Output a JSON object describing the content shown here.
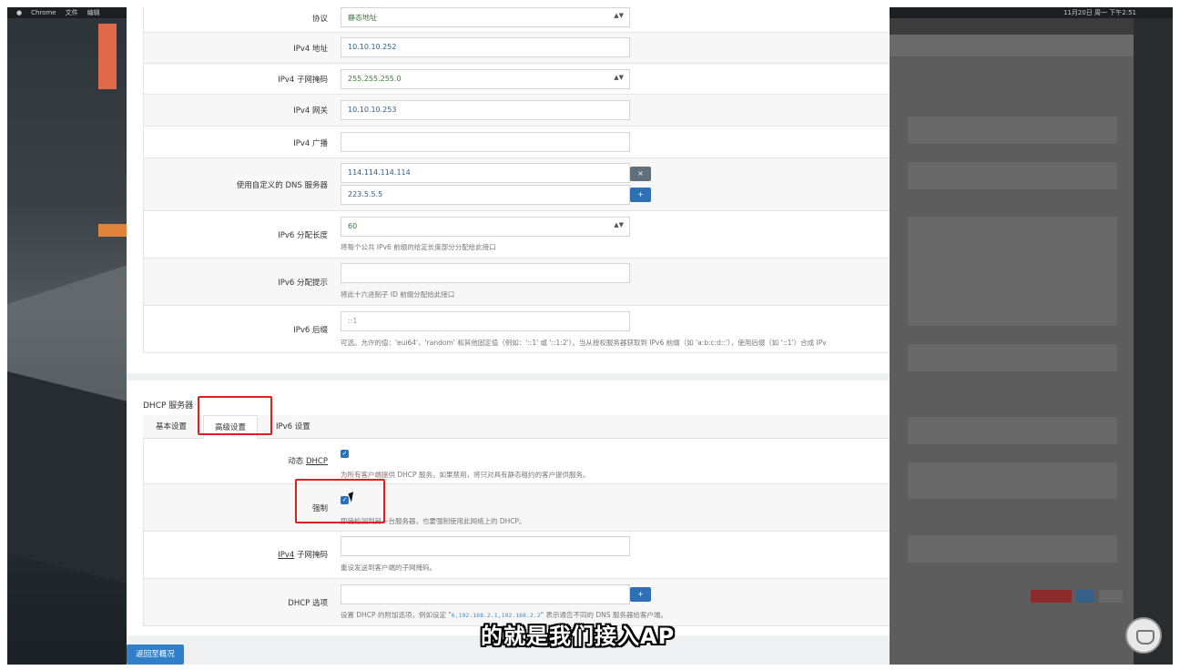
{
  "menubar": {
    "app": "Chrome",
    "items": [
      "文件",
      "编辑"
    ],
    "clock": "11月20日 周一 下午2:51"
  },
  "network": {
    "protocol": {
      "label": "协议",
      "value": "静态地址"
    },
    "ipv4_address": {
      "label": "IPv4 地址",
      "value": "10.10.10.252"
    },
    "ipv4_netmask": {
      "label": "IPv4 子网掩码",
      "value": "255.255.255.0"
    },
    "ipv4_gateway": {
      "label": "IPv4 网关",
      "value": "10.10.10.253"
    },
    "ipv4_broadcast": {
      "label": "IPv4 广播",
      "value": ""
    },
    "dns": {
      "label": "使用自定义的 DNS 服务器",
      "values": [
        "114.114.114.114",
        "223.5.5.5"
      ],
      "remove_btn": "×",
      "add_btn": "+"
    },
    "ipv6_assign_len": {
      "label": "IPv6 分配长度",
      "value": "60",
      "hint": "将每个公共 IPv6 前缀的给定长度部分分配给此接口"
    },
    "ipv6_assign_hint": {
      "label": "IPv6 分配提示",
      "value": "",
      "hint": "将此十六进制子 ID 前缀分配给此接口"
    },
    "ipv6_suffix": {
      "label": "IPv6 后缀",
      "value": "::1",
      "hint": "可选。允许的值：'eui64'、'random' 和其他固定值（例如：'::1' 或 '::1:2'）。当从授权服务器获取到 IPv6 前缀（如 'a:b:c:d::'），使用后缀（如 '::1'）合成 IPv"
    }
  },
  "dhcp": {
    "title": "DHCP 服务器",
    "tabs": [
      "基本设置",
      "高级设置",
      "IPv6 设置"
    ],
    "dynamic": {
      "label_prefix": "动态 ",
      "label_link": "DHCP",
      "checked": true,
      "hint": "为所有客户端提供 DHCP 服务。如果禁用，将只对具有静态租约的客户提供服务。"
    },
    "force": {
      "label": "强制",
      "checked": true,
      "hint": "即使检测到另一台服务器，也要强制使用此网络上的 DHCP。"
    },
    "netmask": {
      "label_link": "IPv4",
      "label_suffix": " 子网掩码",
      "value": "",
      "hint": "重设发送到客户端的子网掩码。"
    },
    "options": {
      "label": "DHCP 选项",
      "value": "",
      "add_btn": "+",
      "hint_prefix": "设置 DHCP 的附加选项，例如设定 \"",
      "hint_code": "6,192.168.2.1,192.168.2.2",
      "hint_suffix": "\" 表示通告不同的 DNS 服务器给客户端。"
    }
  },
  "footer": {
    "back_button": "返回至概况"
  },
  "subtitle": "的就是我们接入AP",
  "colors": {
    "accent": "#2f6fb3",
    "highlight": "#e02020",
    "back_button": "#2f7fc9"
  }
}
